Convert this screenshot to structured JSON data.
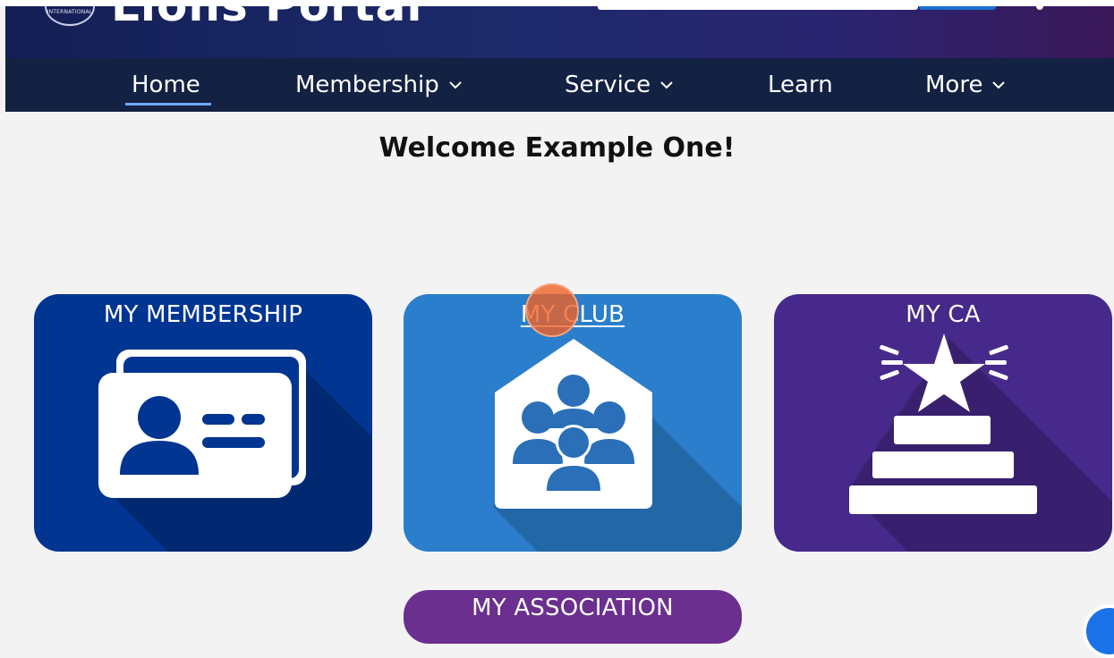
{
  "header": {
    "portal_title": "Lions Portal",
    "seal_text": "INTERNATIONAL"
  },
  "nav": {
    "items": [
      {
        "label": "Home",
        "dropdown": false,
        "active": true
      },
      {
        "label": "Membership",
        "dropdown": true,
        "active": false
      },
      {
        "label": "Service",
        "dropdown": true,
        "active": false
      },
      {
        "label": "Learn",
        "dropdown": false,
        "active": false
      },
      {
        "label": "More",
        "dropdown": true,
        "active": false
      }
    ]
  },
  "welcome": "Welcome Example One!",
  "tiles": [
    {
      "label": "MY MEMBERSHIP",
      "color": "#003591",
      "icon": "membership-card-icon"
    },
    {
      "label": "MY CLUB",
      "color": "#2a7ecb",
      "icon": "club-house-icon"
    },
    {
      "label": "MY CA",
      "color": "#46298a",
      "icon": "star-podium-icon"
    },
    {
      "label": "MY ASSOCIATION",
      "color": "#6a2f8f",
      "icon": ""
    }
  ],
  "colors": {
    "nav_bg": "#132142",
    "banner_start": "#141f55",
    "page_bg": "#f3f3f3",
    "active_underline": "#6fa8ff"
  }
}
